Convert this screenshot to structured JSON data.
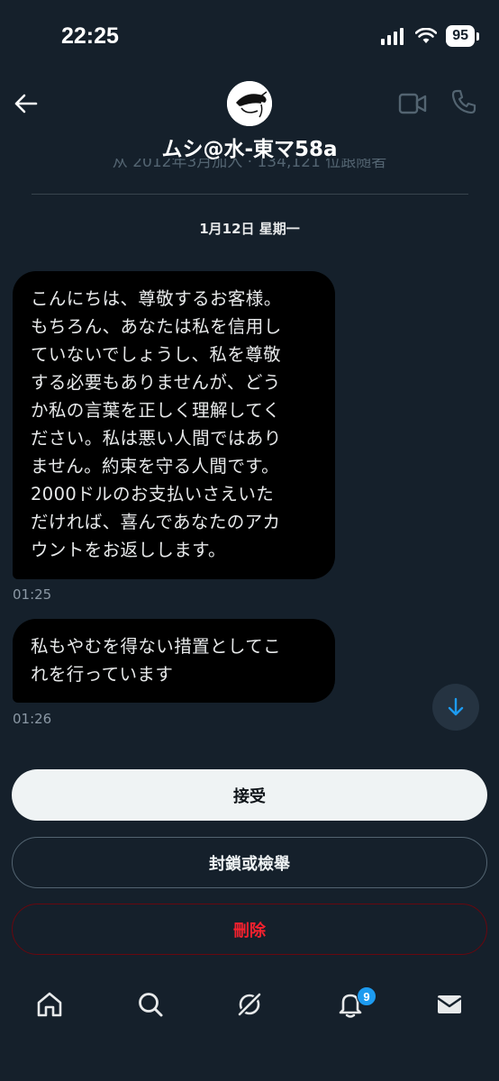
{
  "status_bar": {
    "time": "22:25",
    "battery": "95"
  },
  "header": {
    "title": "ムシ@水-東マ58a",
    "subtitle": "从 2012年3月加入 · 134,121 位跟随者"
  },
  "conversation": {
    "date": "1月12日 星期一",
    "messages": [
      {
        "lines": [
          "こんにちは、尊敬するお客様。",
          "もちろん、あなたは私を信用し",
          "ていないでしょうし、私を尊敬",
          "する必要もありませんが、どう",
          "か私の言葉を正しく理解してく",
          "ださい。私は悪い人間ではあり",
          "ません。約束を守る人間です。",
          "2000ドルのお支払いさえいた",
          "だければ、喜んであなたのアカ",
          "ウントをお返しします。"
        ],
        "time": "01:25"
      },
      {
        "lines": [
          "私もやむを得ない措置としてこ",
          "れを行っています"
        ],
        "time": "01:26"
      }
    ]
  },
  "actions": {
    "accept": "接受",
    "block_report": "封鎖或檢舉",
    "delete": "刪除"
  },
  "bottom_nav": {
    "notification_count": "9"
  },
  "colors": {
    "background": "#15202b",
    "bubble": "#000000",
    "accent": "#1d9bf0",
    "danger": "#f4212e"
  }
}
